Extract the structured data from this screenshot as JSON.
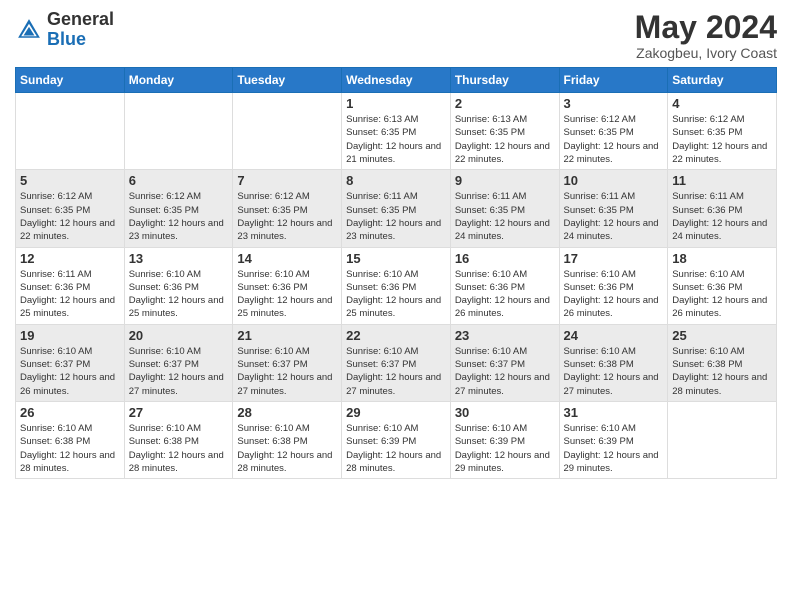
{
  "header": {
    "logo_general": "General",
    "logo_blue": "Blue",
    "month_year": "May 2024",
    "location": "Zakogbeu, Ivory Coast"
  },
  "days_of_week": [
    "Sunday",
    "Monday",
    "Tuesday",
    "Wednesday",
    "Thursday",
    "Friday",
    "Saturday"
  ],
  "weeks": [
    [
      {
        "day": "",
        "sunrise": "",
        "sunset": "",
        "daylight": ""
      },
      {
        "day": "",
        "sunrise": "",
        "sunset": "",
        "daylight": ""
      },
      {
        "day": "",
        "sunrise": "",
        "sunset": "",
        "daylight": ""
      },
      {
        "day": "1",
        "sunrise": "Sunrise: 6:13 AM",
        "sunset": "Sunset: 6:35 PM",
        "daylight": "Daylight: 12 hours and 21 minutes."
      },
      {
        "day": "2",
        "sunrise": "Sunrise: 6:13 AM",
        "sunset": "Sunset: 6:35 PM",
        "daylight": "Daylight: 12 hours and 22 minutes."
      },
      {
        "day": "3",
        "sunrise": "Sunrise: 6:12 AM",
        "sunset": "Sunset: 6:35 PM",
        "daylight": "Daylight: 12 hours and 22 minutes."
      },
      {
        "day": "4",
        "sunrise": "Sunrise: 6:12 AM",
        "sunset": "Sunset: 6:35 PM",
        "daylight": "Daylight: 12 hours and 22 minutes."
      }
    ],
    [
      {
        "day": "5",
        "sunrise": "Sunrise: 6:12 AM",
        "sunset": "Sunset: 6:35 PM",
        "daylight": "Daylight: 12 hours and 22 minutes."
      },
      {
        "day": "6",
        "sunrise": "Sunrise: 6:12 AM",
        "sunset": "Sunset: 6:35 PM",
        "daylight": "Daylight: 12 hours and 23 minutes."
      },
      {
        "day": "7",
        "sunrise": "Sunrise: 6:12 AM",
        "sunset": "Sunset: 6:35 PM",
        "daylight": "Daylight: 12 hours and 23 minutes."
      },
      {
        "day": "8",
        "sunrise": "Sunrise: 6:11 AM",
        "sunset": "Sunset: 6:35 PM",
        "daylight": "Daylight: 12 hours and 23 minutes."
      },
      {
        "day": "9",
        "sunrise": "Sunrise: 6:11 AM",
        "sunset": "Sunset: 6:35 PM",
        "daylight": "Daylight: 12 hours and 24 minutes."
      },
      {
        "day": "10",
        "sunrise": "Sunrise: 6:11 AM",
        "sunset": "Sunset: 6:35 PM",
        "daylight": "Daylight: 12 hours and 24 minutes."
      },
      {
        "day": "11",
        "sunrise": "Sunrise: 6:11 AM",
        "sunset": "Sunset: 6:36 PM",
        "daylight": "Daylight: 12 hours and 24 minutes."
      }
    ],
    [
      {
        "day": "12",
        "sunrise": "Sunrise: 6:11 AM",
        "sunset": "Sunset: 6:36 PM",
        "daylight": "Daylight: 12 hours and 25 minutes."
      },
      {
        "day": "13",
        "sunrise": "Sunrise: 6:10 AM",
        "sunset": "Sunset: 6:36 PM",
        "daylight": "Daylight: 12 hours and 25 minutes."
      },
      {
        "day": "14",
        "sunrise": "Sunrise: 6:10 AM",
        "sunset": "Sunset: 6:36 PM",
        "daylight": "Daylight: 12 hours and 25 minutes."
      },
      {
        "day": "15",
        "sunrise": "Sunrise: 6:10 AM",
        "sunset": "Sunset: 6:36 PM",
        "daylight": "Daylight: 12 hours and 25 minutes."
      },
      {
        "day": "16",
        "sunrise": "Sunrise: 6:10 AM",
        "sunset": "Sunset: 6:36 PM",
        "daylight": "Daylight: 12 hours and 26 minutes."
      },
      {
        "day": "17",
        "sunrise": "Sunrise: 6:10 AM",
        "sunset": "Sunset: 6:36 PM",
        "daylight": "Daylight: 12 hours and 26 minutes."
      },
      {
        "day": "18",
        "sunrise": "Sunrise: 6:10 AM",
        "sunset": "Sunset: 6:36 PM",
        "daylight": "Daylight: 12 hours and 26 minutes."
      }
    ],
    [
      {
        "day": "19",
        "sunrise": "Sunrise: 6:10 AM",
        "sunset": "Sunset: 6:37 PM",
        "daylight": "Daylight: 12 hours and 26 minutes."
      },
      {
        "day": "20",
        "sunrise": "Sunrise: 6:10 AM",
        "sunset": "Sunset: 6:37 PM",
        "daylight": "Daylight: 12 hours and 27 minutes."
      },
      {
        "day": "21",
        "sunrise": "Sunrise: 6:10 AM",
        "sunset": "Sunset: 6:37 PM",
        "daylight": "Daylight: 12 hours and 27 minutes."
      },
      {
        "day": "22",
        "sunrise": "Sunrise: 6:10 AM",
        "sunset": "Sunset: 6:37 PM",
        "daylight": "Daylight: 12 hours and 27 minutes."
      },
      {
        "day": "23",
        "sunrise": "Sunrise: 6:10 AM",
        "sunset": "Sunset: 6:37 PM",
        "daylight": "Daylight: 12 hours and 27 minutes."
      },
      {
        "day": "24",
        "sunrise": "Sunrise: 6:10 AM",
        "sunset": "Sunset: 6:38 PM",
        "daylight": "Daylight: 12 hours and 27 minutes."
      },
      {
        "day": "25",
        "sunrise": "Sunrise: 6:10 AM",
        "sunset": "Sunset: 6:38 PM",
        "daylight": "Daylight: 12 hours and 28 minutes."
      }
    ],
    [
      {
        "day": "26",
        "sunrise": "Sunrise: 6:10 AM",
        "sunset": "Sunset: 6:38 PM",
        "daylight": "Daylight: 12 hours and 28 minutes."
      },
      {
        "day": "27",
        "sunrise": "Sunrise: 6:10 AM",
        "sunset": "Sunset: 6:38 PM",
        "daylight": "Daylight: 12 hours and 28 minutes."
      },
      {
        "day": "28",
        "sunrise": "Sunrise: 6:10 AM",
        "sunset": "Sunset: 6:38 PM",
        "daylight": "Daylight: 12 hours and 28 minutes."
      },
      {
        "day": "29",
        "sunrise": "Sunrise: 6:10 AM",
        "sunset": "Sunset: 6:39 PM",
        "daylight": "Daylight: 12 hours and 28 minutes."
      },
      {
        "day": "30",
        "sunrise": "Sunrise: 6:10 AM",
        "sunset": "Sunset: 6:39 PM",
        "daylight": "Daylight: 12 hours and 29 minutes."
      },
      {
        "day": "31",
        "sunrise": "Sunrise: 6:10 AM",
        "sunset": "Sunset: 6:39 PM",
        "daylight": "Daylight: 12 hours and 29 minutes."
      },
      {
        "day": "",
        "sunrise": "",
        "sunset": "",
        "daylight": ""
      }
    ]
  ]
}
